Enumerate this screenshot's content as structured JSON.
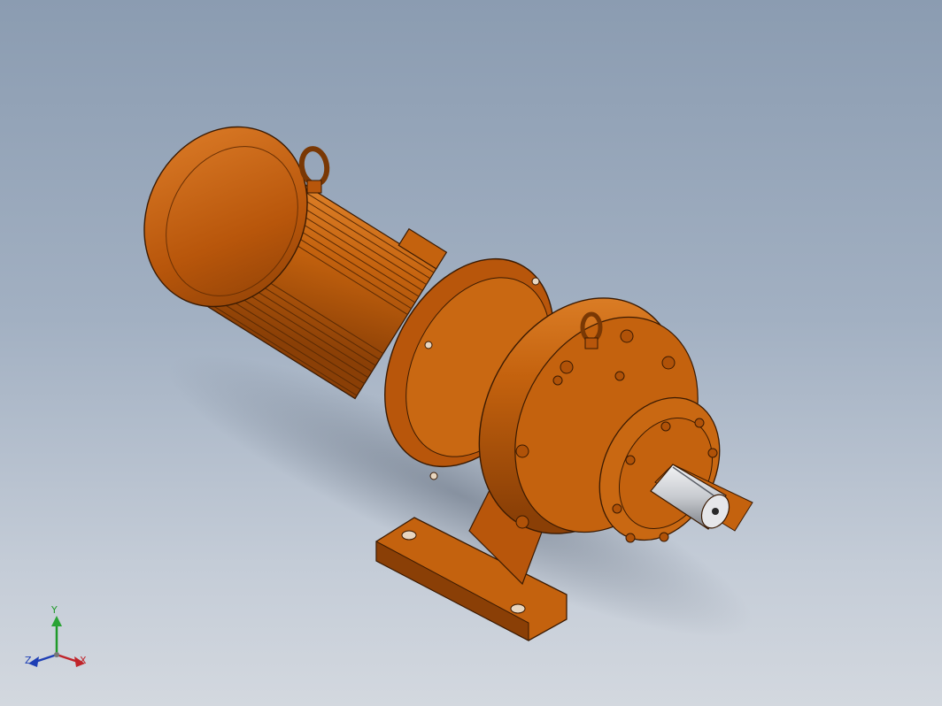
{
  "viewport": {
    "background_top": "#8b9cb1",
    "background_bottom": "#d3d8df",
    "model": {
      "name": "cycloidal-gear-reducer-motor",
      "body_color": "#c4620e",
      "shade_color": "#8a3f06",
      "highlight_color": "#e58a3a",
      "shaft_color": "#c8cbd0"
    }
  },
  "triad": {
    "y_label": "Y",
    "z_label": "Z",
    "x_label": "X",
    "y_color": "#1f9a2a",
    "x_color": "#c0242a",
    "z_color": "#1e3fb5"
  }
}
